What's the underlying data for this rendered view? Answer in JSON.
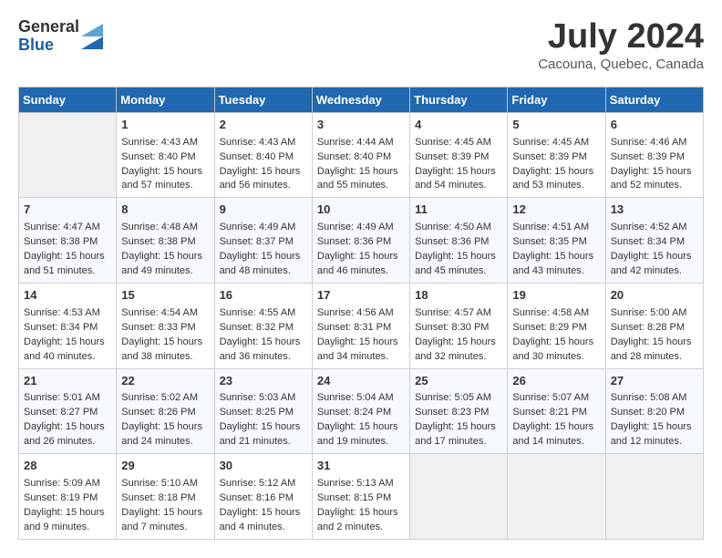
{
  "header": {
    "logo_general": "General",
    "logo_blue": "Blue",
    "month_title": "July 2024",
    "location": "Cacouna, Quebec, Canada"
  },
  "days_of_week": [
    "Sunday",
    "Monday",
    "Tuesday",
    "Wednesday",
    "Thursday",
    "Friday",
    "Saturday"
  ],
  "weeks": [
    [
      {
        "day": "",
        "empty": true
      },
      {
        "day": "1",
        "sunrise": "Sunrise: 4:43 AM",
        "sunset": "Sunset: 8:40 PM",
        "daylight": "Daylight: 15 hours and 57 minutes."
      },
      {
        "day": "2",
        "sunrise": "Sunrise: 4:43 AM",
        "sunset": "Sunset: 8:40 PM",
        "daylight": "Daylight: 15 hours and 56 minutes."
      },
      {
        "day": "3",
        "sunrise": "Sunrise: 4:44 AM",
        "sunset": "Sunset: 8:40 PM",
        "daylight": "Daylight: 15 hours and 55 minutes."
      },
      {
        "day": "4",
        "sunrise": "Sunrise: 4:45 AM",
        "sunset": "Sunset: 8:39 PM",
        "daylight": "Daylight: 15 hours and 54 minutes."
      },
      {
        "day": "5",
        "sunrise": "Sunrise: 4:45 AM",
        "sunset": "Sunset: 8:39 PM",
        "daylight": "Daylight: 15 hours and 53 minutes."
      },
      {
        "day": "6",
        "sunrise": "Sunrise: 4:46 AM",
        "sunset": "Sunset: 8:39 PM",
        "daylight": "Daylight: 15 hours and 52 minutes."
      }
    ],
    [
      {
        "day": "7",
        "sunrise": "Sunrise: 4:47 AM",
        "sunset": "Sunset: 8:38 PM",
        "daylight": "Daylight: 15 hours and 51 minutes."
      },
      {
        "day": "8",
        "sunrise": "Sunrise: 4:48 AM",
        "sunset": "Sunset: 8:38 PM",
        "daylight": "Daylight: 15 hours and 49 minutes."
      },
      {
        "day": "9",
        "sunrise": "Sunrise: 4:49 AM",
        "sunset": "Sunset: 8:37 PM",
        "daylight": "Daylight: 15 hours and 48 minutes."
      },
      {
        "day": "10",
        "sunrise": "Sunrise: 4:49 AM",
        "sunset": "Sunset: 8:36 PM",
        "daylight": "Daylight: 15 hours and 46 minutes."
      },
      {
        "day": "11",
        "sunrise": "Sunrise: 4:50 AM",
        "sunset": "Sunset: 8:36 PM",
        "daylight": "Daylight: 15 hours and 45 minutes."
      },
      {
        "day": "12",
        "sunrise": "Sunrise: 4:51 AM",
        "sunset": "Sunset: 8:35 PM",
        "daylight": "Daylight: 15 hours and 43 minutes."
      },
      {
        "day": "13",
        "sunrise": "Sunrise: 4:52 AM",
        "sunset": "Sunset: 8:34 PM",
        "daylight": "Daylight: 15 hours and 42 minutes."
      }
    ],
    [
      {
        "day": "14",
        "sunrise": "Sunrise: 4:53 AM",
        "sunset": "Sunset: 8:34 PM",
        "daylight": "Daylight: 15 hours and 40 minutes."
      },
      {
        "day": "15",
        "sunrise": "Sunrise: 4:54 AM",
        "sunset": "Sunset: 8:33 PM",
        "daylight": "Daylight: 15 hours and 38 minutes."
      },
      {
        "day": "16",
        "sunrise": "Sunrise: 4:55 AM",
        "sunset": "Sunset: 8:32 PM",
        "daylight": "Daylight: 15 hours and 36 minutes."
      },
      {
        "day": "17",
        "sunrise": "Sunrise: 4:56 AM",
        "sunset": "Sunset: 8:31 PM",
        "daylight": "Daylight: 15 hours and 34 minutes."
      },
      {
        "day": "18",
        "sunrise": "Sunrise: 4:57 AM",
        "sunset": "Sunset: 8:30 PM",
        "daylight": "Daylight: 15 hours and 32 minutes."
      },
      {
        "day": "19",
        "sunrise": "Sunrise: 4:58 AM",
        "sunset": "Sunset: 8:29 PM",
        "daylight": "Daylight: 15 hours and 30 minutes."
      },
      {
        "day": "20",
        "sunrise": "Sunrise: 5:00 AM",
        "sunset": "Sunset: 8:28 PM",
        "daylight": "Daylight: 15 hours and 28 minutes."
      }
    ],
    [
      {
        "day": "21",
        "sunrise": "Sunrise: 5:01 AM",
        "sunset": "Sunset: 8:27 PM",
        "daylight": "Daylight: 15 hours and 26 minutes."
      },
      {
        "day": "22",
        "sunrise": "Sunrise: 5:02 AM",
        "sunset": "Sunset: 8:26 PM",
        "daylight": "Daylight: 15 hours and 24 minutes."
      },
      {
        "day": "23",
        "sunrise": "Sunrise: 5:03 AM",
        "sunset": "Sunset: 8:25 PM",
        "daylight": "Daylight: 15 hours and 21 minutes."
      },
      {
        "day": "24",
        "sunrise": "Sunrise: 5:04 AM",
        "sunset": "Sunset: 8:24 PM",
        "daylight": "Daylight: 15 hours and 19 minutes."
      },
      {
        "day": "25",
        "sunrise": "Sunrise: 5:05 AM",
        "sunset": "Sunset: 8:23 PM",
        "daylight": "Daylight: 15 hours and 17 minutes."
      },
      {
        "day": "26",
        "sunrise": "Sunrise: 5:07 AM",
        "sunset": "Sunset: 8:21 PM",
        "daylight": "Daylight: 15 hours and 14 minutes."
      },
      {
        "day": "27",
        "sunrise": "Sunrise: 5:08 AM",
        "sunset": "Sunset: 8:20 PM",
        "daylight": "Daylight: 15 hours and 12 minutes."
      }
    ],
    [
      {
        "day": "28",
        "sunrise": "Sunrise: 5:09 AM",
        "sunset": "Sunset: 8:19 PM",
        "daylight": "Daylight: 15 hours and 9 minutes."
      },
      {
        "day": "29",
        "sunrise": "Sunrise: 5:10 AM",
        "sunset": "Sunset: 8:18 PM",
        "daylight": "Daylight: 15 hours and 7 minutes."
      },
      {
        "day": "30",
        "sunrise": "Sunrise: 5:12 AM",
        "sunset": "Sunset: 8:16 PM",
        "daylight": "Daylight: 15 hours and 4 minutes."
      },
      {
        "day": "31",
        "sunrise": "Sunrise: 5:13 AM",
        "sunset": "Sunset: 8:15 PM",
        "daylight": "Daylight: 15 hours and 2 minutes."
      },
      {
        "day": "",
        "empty": true
      },
      {
        "day": "",
        "empty": true
      },
      {
        "day": "",
        "empty": true
      }
    ]
  ]
}
